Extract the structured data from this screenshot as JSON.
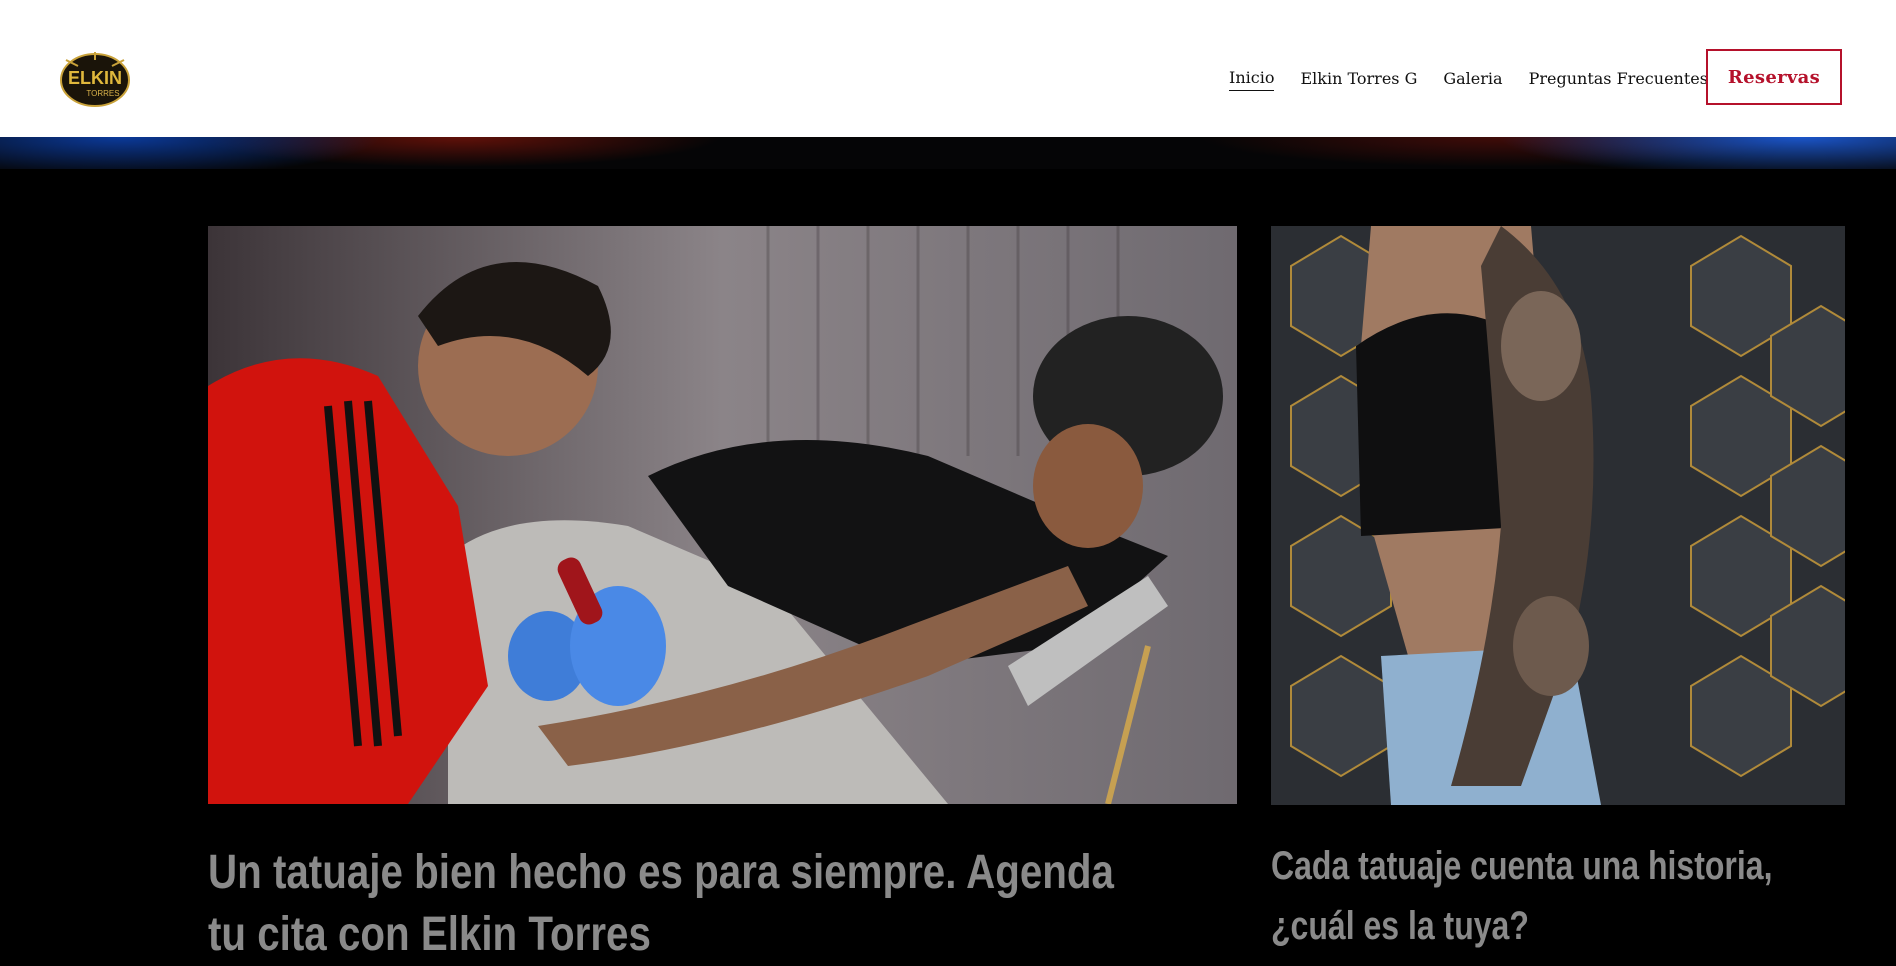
{
  "header": {
    "logo": {
      "line1": "ELKIN",
      "line2": "TORRES"
    },
    "nav": [
      {
        "label": "Inicio",
        "active": true
      },
      {
        "label": "Elkin Torres G",
        "active": false
      },
      {
        "label": "Galeria",
        "active": false
      },
      {
        "label": "Preguntas Frecuentes",
        "active": false
      }
    ],
    "cta_label": "Reservas",
    "accent_color": "#b5112b"
  },
  "sections": [
    {
      "image_icon": "tattoo-session-photo",
      "heading": "Un tatuaje bien hecho es para siempre. Agenda tu cita con Elkin Torres"
    },
    {
      "image_icon": "tattoo-sleeve-photo",
      "heading": "Cada tatuaje cuenta una historia, ¿cuál es la tuya?"
    }
  ],
  "colors": {
    "page_background": "#000000",
    "heading_text": "#8a8a8a"
  }
}
